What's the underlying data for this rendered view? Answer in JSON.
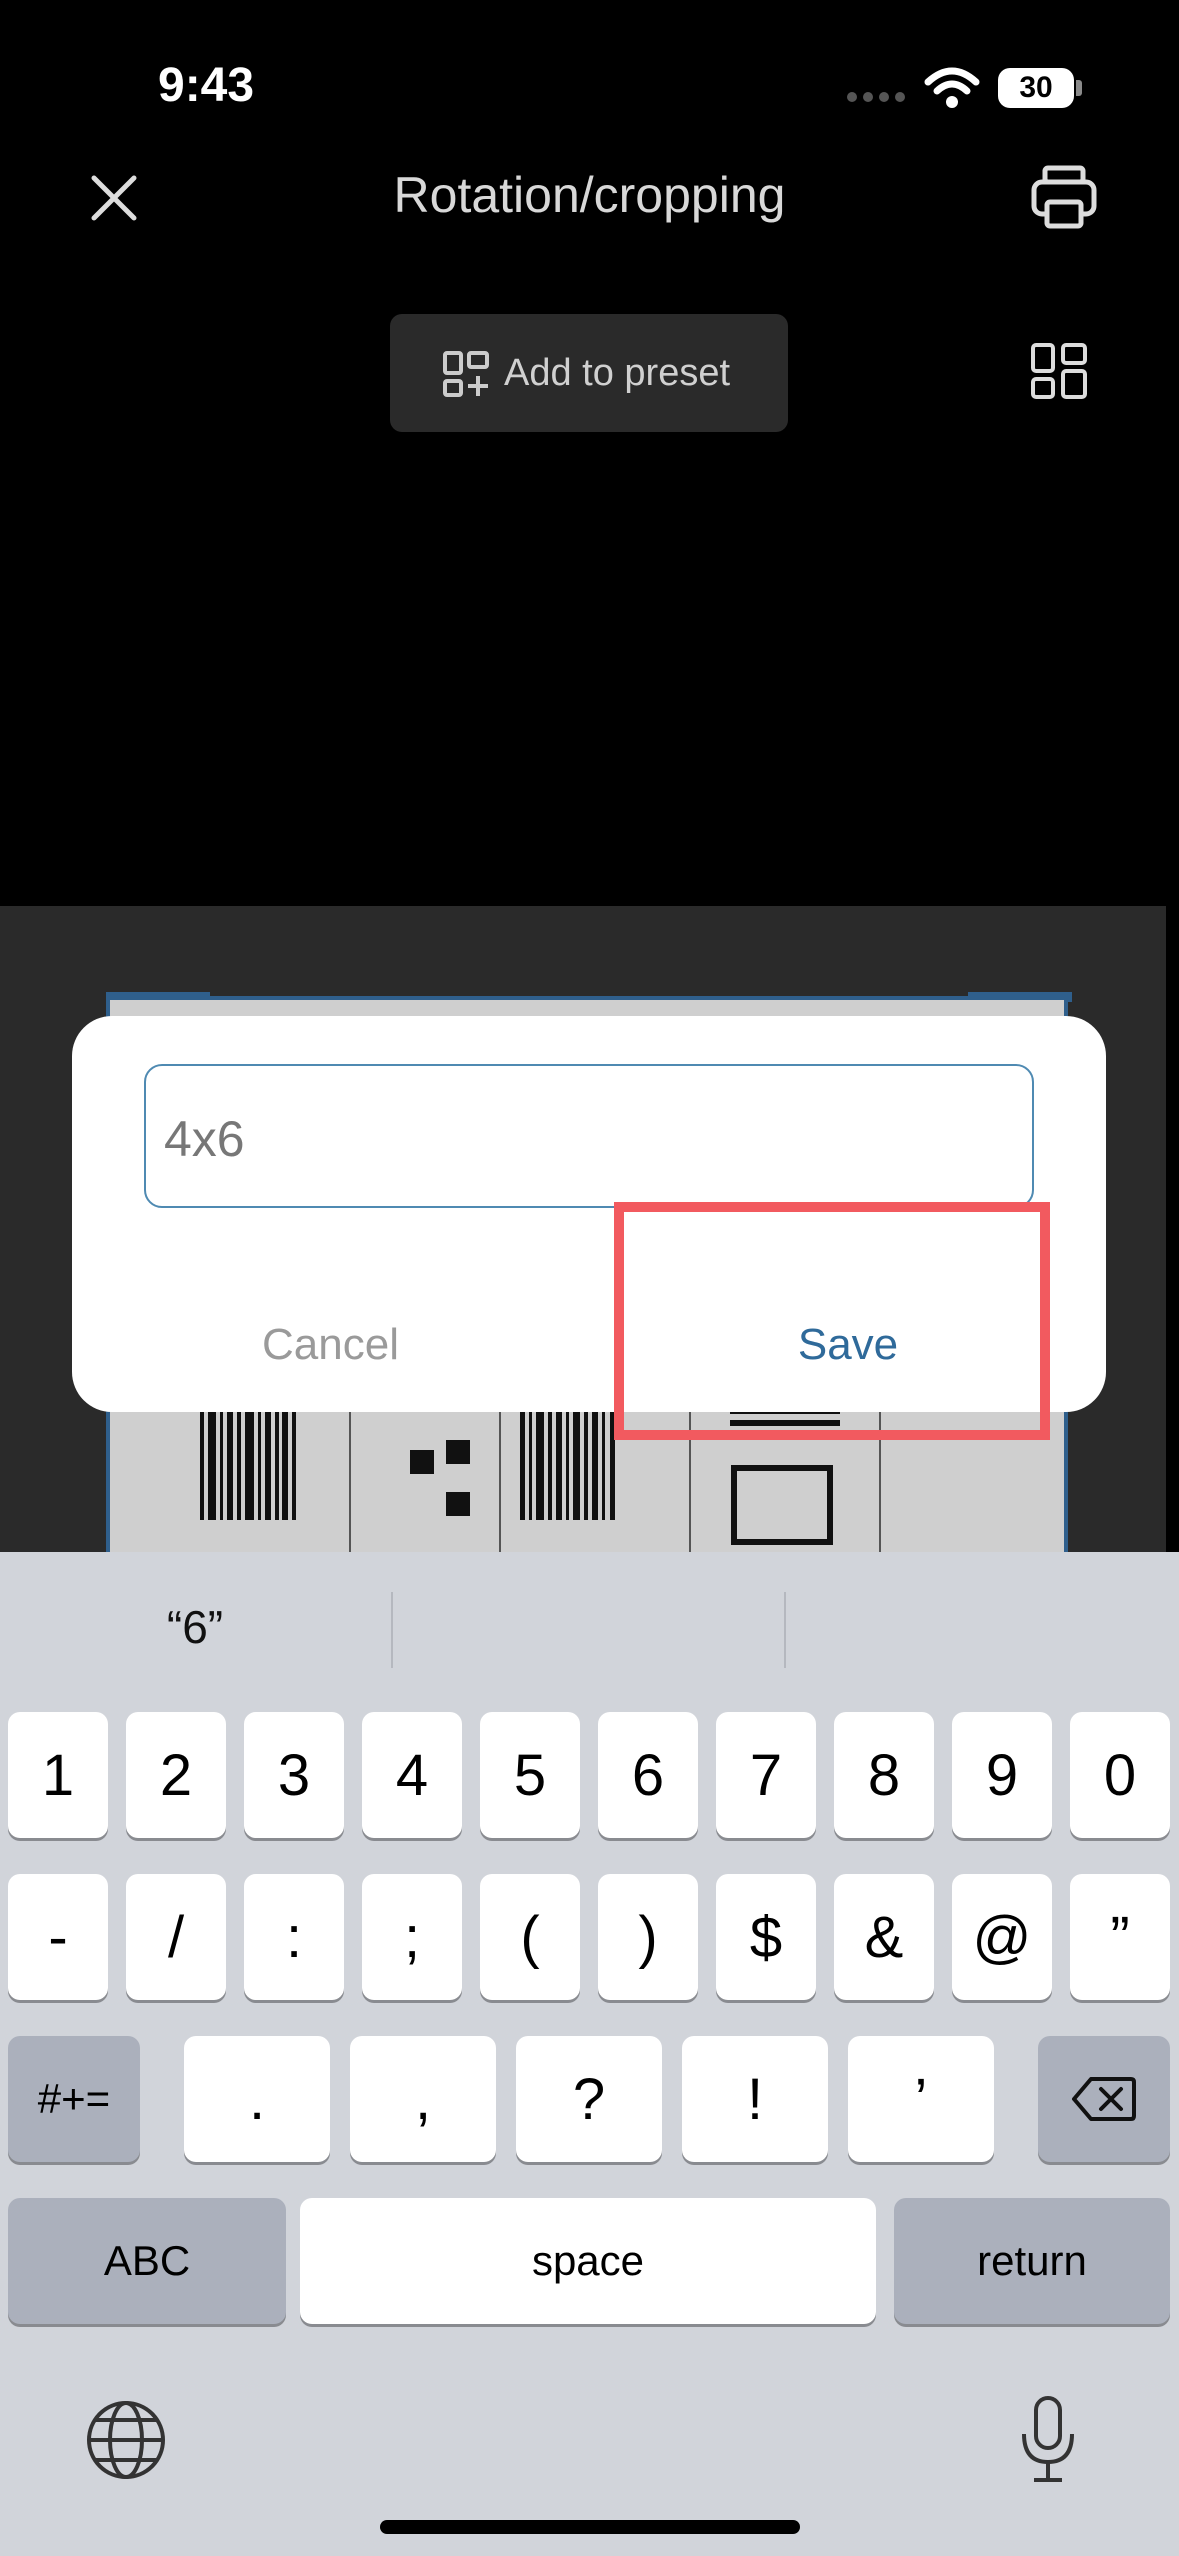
{
  "status_bar": {
    "time": "9:43",
    "battery": "30"
  },
  "header": {
    "title": "Rotation/cropping",
    "add_to_preset": "Add to preset"
  },
  "dialog": {
    "input_value": "4x6",
    "cancel_label": "Cancel",
    "save_label": "Save"
  },
  "keyboard": {
    "suggestions": [
      "“6”",
      "",
      ""
    ],
    "row1": [
      "1",
      "2",
      "3",
      "4",
      "5",
      "6",
      "7",
      "8",
      "9",
      "0"
    ],
    "row2": [
      "-",
      "/",
      ":",
      ";",
      "(",
      ")",
      "$",
      "&",
      "@",
      "”"
    ],
    "row3": [
      ".",
      ",",
      "?",
      "!",
      "’"
    ],
    "mode_key": "#+=",
    "abc_key": "ABC",
    "space_key": "space",
    "return_key": "return"
  },
  "icons": [
    "close-icon",
    "printer-icon",
    "add-preset-icon",
    "grid-layout-icon",
    "backspace-icon",
    "globe-icon",
    "microphone-icon",
    "wifi-icon",
    "signal-icon"
  ],
  "colors": {
    "highlight": "#f25a5f",
    "accent": "#2f6a9a"
  }
}
